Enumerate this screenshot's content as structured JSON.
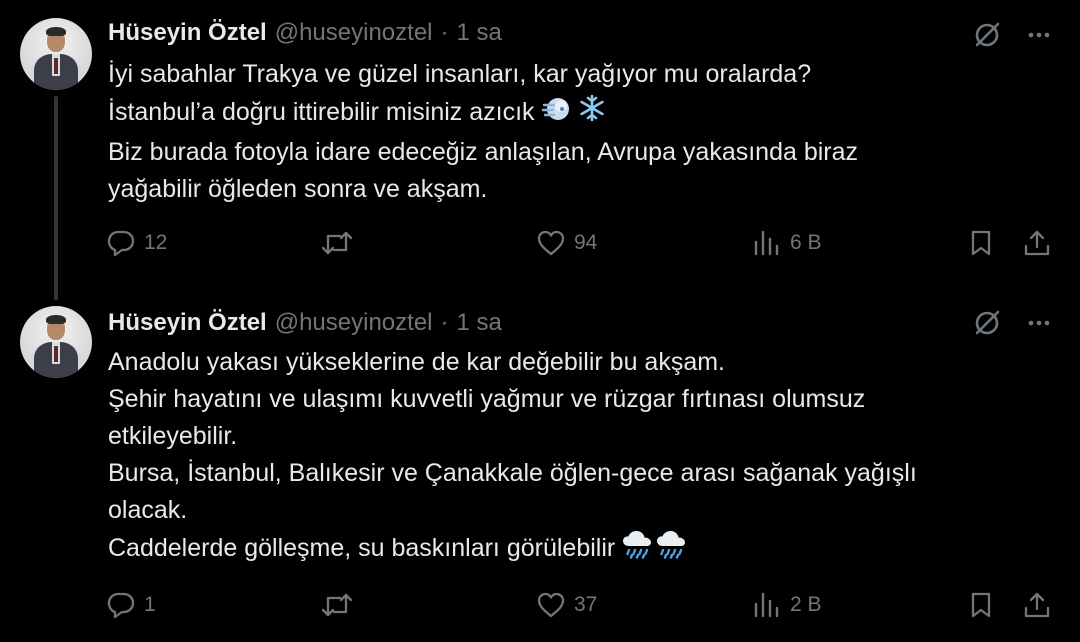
{
  "tweets": [
    {
      "author_name": "Hüseyin Öztel",
      "handle": "@huseyinoztel",
      "separator": "·",
      "time": "1 sa",
      "lines": [
        "İyi sabahlar Trakya ve güzel insanları, kar yağıyor mu oralarda?",
        "İstanbul’a doğru ittirebilir misiniz azıcık",
        "Biz burada fotoyla idare edeceğiz anlaşılan, Avrupa yakasında biraz",
        "yağabilir öğleden sonra ve akşam."
      ],
      "emojis": [
        "wind-face-emoji",
        "snowflake-emoji"
      ],
      "replies": "12",
      "retweets": "",
      "likes": "94",
      "views": "6 B"
    },
    {
      "author_name": "Hüseyin Öztel",
      "handle": "@huseyinoztel",
      "separator": "·",
      "time": "1 sa",
      "lines": [
        "Anadolu yakası yükseklerine de kar değebilir bu akşam.",
        "Şehir hayatını ve ulaşımı kuvvetli yağmur ve rüzgar fırtınası olumsuz",
        "etkileyebilir.",
        "Bursa, İstanbul, Balıkesir ve Çanakkale öğlen-gece arası sağanak yağışlı",
        "olacak.",
        "Caddelerde gölleşme, su baskınları görülebilir"
      ],
      "emojis": [
        "rain-cloud-emoji",
        "rain-cloud-emoji"
      ],
      "replies": "1",
      "retweets": "",
      "likes": "37",
      "views": "2 B"
    }
  ],
  "colors": {
    "background": "#000000",
    "text": "#e7e9ea",
    "muted": "#71767b",
    "thread_line": "#333639"
  }
}
